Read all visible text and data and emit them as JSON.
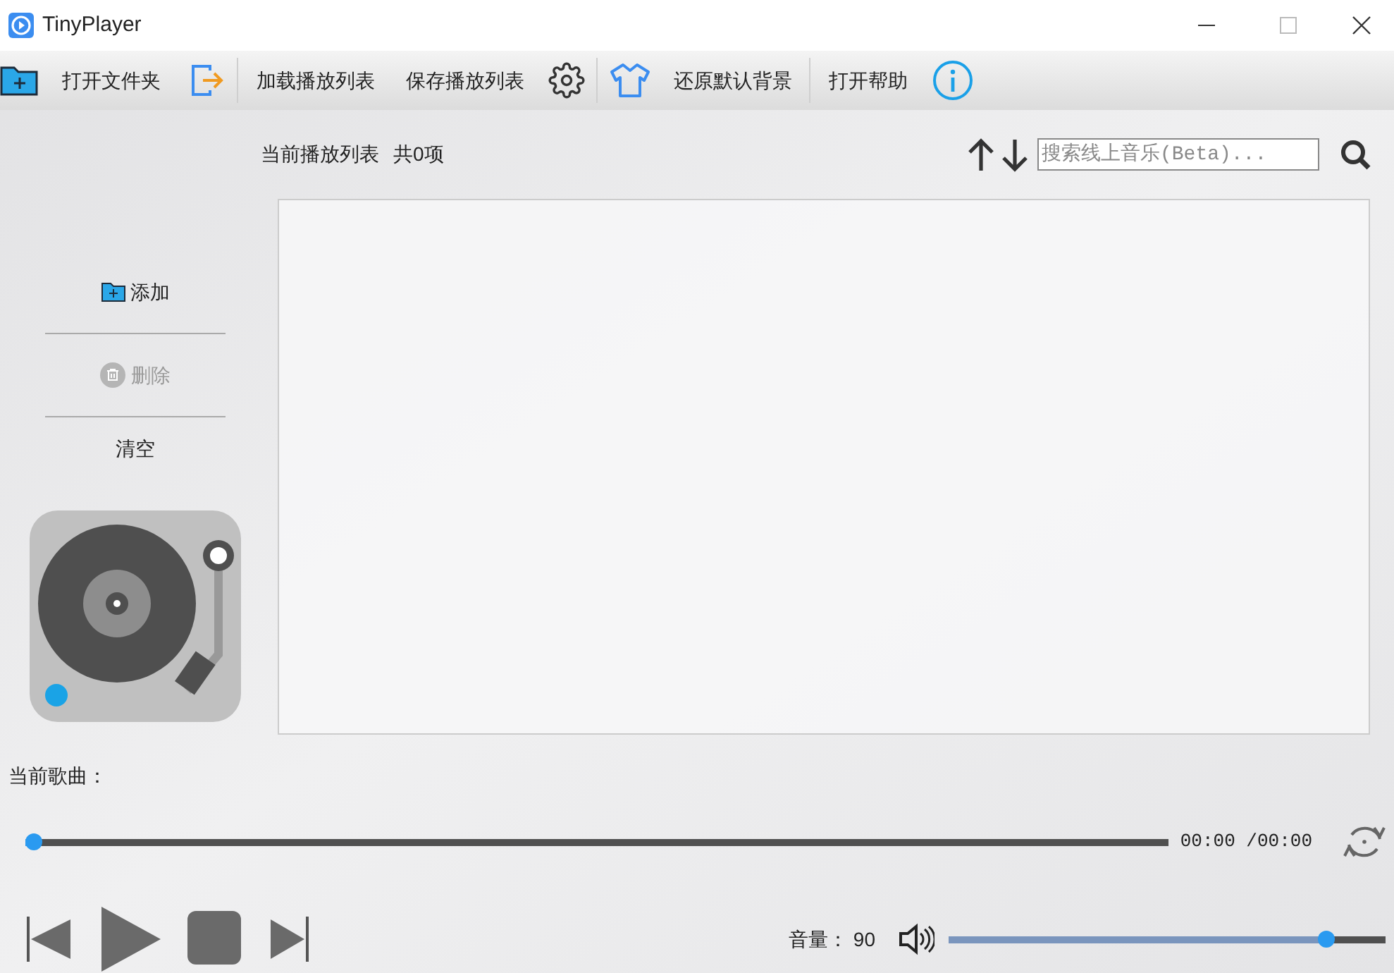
{
  "window": {
    "title": "TinyPlayer"
  },
  "toolbar": [
    {
      "kind": "folder-plus",
      "label": "打开文件夹"
    },
    {
      "kind": "export"
    },
    {
      "kind": "text",
      "label": "加载播放列表"
    },
    {
      "kind": "text",
      "label": "保存播放列表"
    },
    {
      "kind": "gear"
    },
    {
      "kind": "shirt",
      "label": "还原默认背景"
    },
    {
      "kind": "text",
      "label": "打开帮助"
    },
    {
      "kind": "info"
    }
  ],
  "playlist": {
    "title": "当前播放列表",
    "count": "共0项",
    "search": {
      "placeholder": "搜索线上音乐(Beta)..."
    }
  },
  "side_actions": [
    {
      "kind": "add",
      "label": "添加",
      "disabled": false
    },
    {
      "kind": "delete",
      "label": "删除",
      "disabled": true
    },
    {
      "kind": "plain",
      "label": "清空",
      "disabled": false
    }
  ],
  "current_song": {
    "label": "当前歌曲："
  },
  "progress": {
    "level": 0.0,
    "time": "00:00 /00:00"
  },
  "volume": {
    "label": "音量：",
    "value": "90",
    "level": 0.88
  }
}
